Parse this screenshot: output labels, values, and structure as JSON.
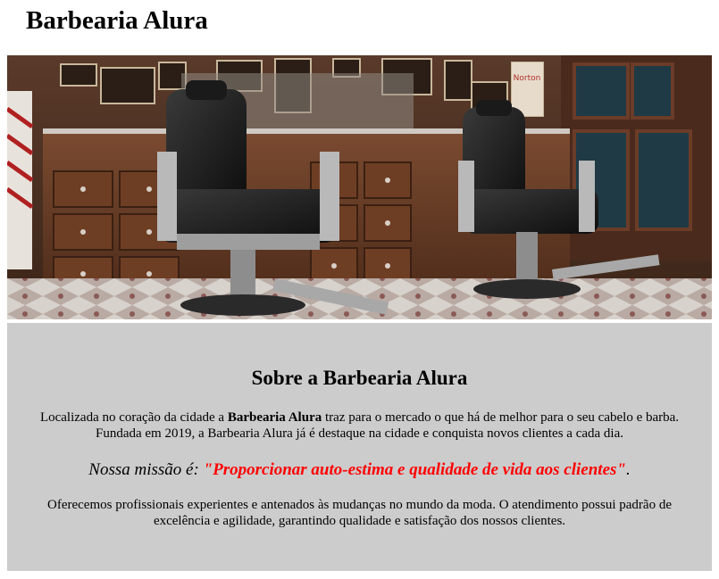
{
  "header": {
    "title": "Barbearia Alura"
  },
  "hero": {
    "image_alt": "barbershop-interior"
  },
  "about": {
    "heading": "Sobre a Barbearia Alura",
    "intro_before": "Localizada no coração da cidade a ",
    "intro_bold": "Barbearia Alura",
    "intro_after": " traz para o mercado o que há de melhor para o seu cabelo e barba. Fundada em 2019, a Barbearia Alura já é destaque na cidade e conquista novos clientes a cada dia.",
    "mission_label": "Nossa missão é: ",
    "mission_quote": "\"Proporcionar auto-estima e qualidade de vida aos clientes\"",
    "mission_end": ".",
    "services": "Oferecemos profissionais experientes e antenados às mudanças no mundo da moda. O atendimento possui padrão de excelência e agilidade, garantindo qualidade e satisfação dos nossos clientes."
  },
  "colors": {
    "section_bg": "#cccccc",
    "mission_highlight": "#ff0000"
  }
}
